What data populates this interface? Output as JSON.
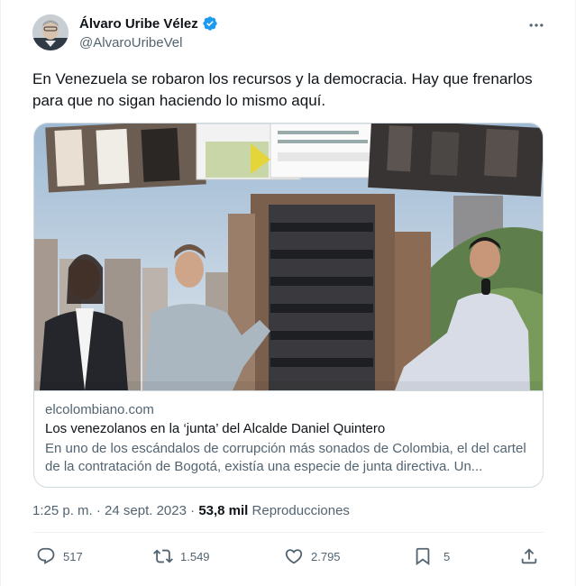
{
  "author": {
    "display_name": "Álvaro Uribe Vélez",
    "handle": "@AlvaroUribeVel",
    "verified": true
  },
  "tweet": {
    "text": "En Venezuela se robaron los recursos y la democracia. Hay que frenarlos para que no sigan haciendo lo mismo aquí."
  },
  "link_card": {
    "domain": "elcolombiano.com",
    "title": "Los venezolanos en la ‘junta’ del Alcalde Daniel Quintero",
    "description": "En uno de los escándalos de corrupción más sonados de Colombia, el del cartel de la contratación de Bogotá, existía una especie de junta directiva. Un..."
  },
  "meta": {
    "time": "1:25 p. m.",
    "separator": "·",
    "date": "24 sept. 2023",
    "views_count": "53,8 mil",
    "views_label": "Reproducciones"
  },
  "actions": {
    "reply_count": "517",
    "retweet_count": "1.549",
    "like_count": "2.795",
    "bookmark_count": "5"
  },
  "colors": {
    "text_primary": "#0f1419",
    "text_secondary": "#536471",
    "verified_blue": "#1d9bf0",
    "border": "#cfd9de"
  },
  "icons": {
    "more": "ellipsis-icon",
    "verified": "verified-badge-icon",
    "reply": "reply-icon",
    "retweet": "retweet-icon",
    "like": "heart-icon",
    "bookmark": "bookmark-icon",
    "share": "share-icon"
  }
}
